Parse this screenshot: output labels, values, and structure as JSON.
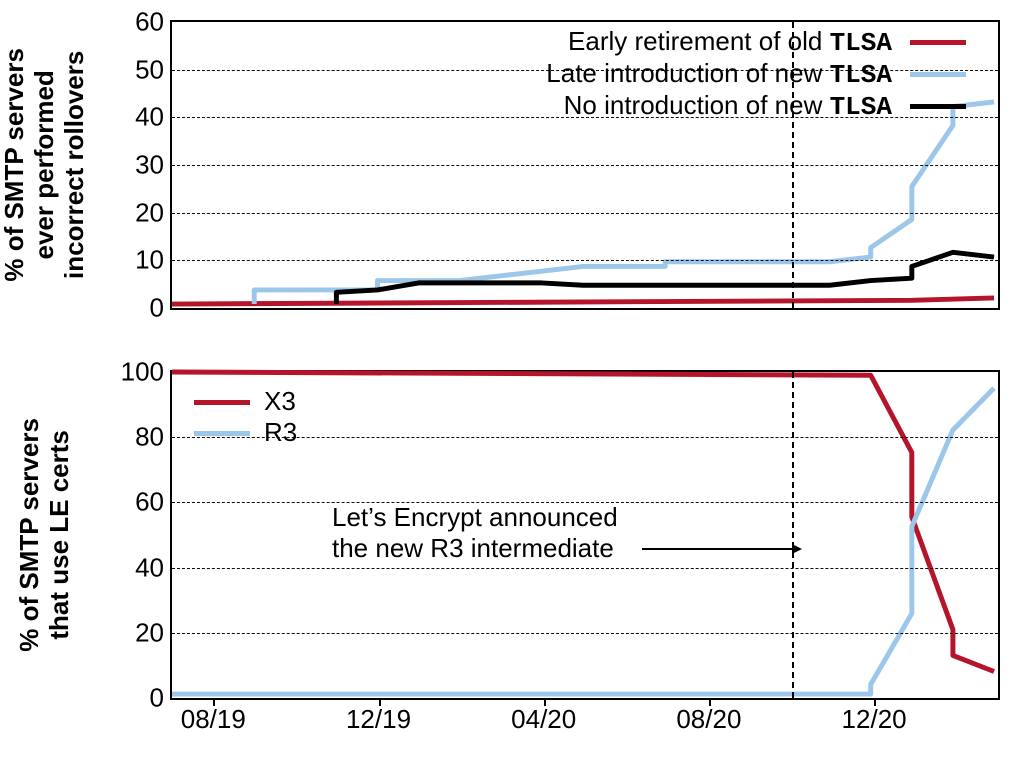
{
  "chart_data": [
    {
      "type": "line",
      "id": "top",
      "title": "",
      "xlabel": "",
      "ylabel_lines": [
        "% of SMTP servers",
        "ever performed",
        "incorrect rollovers"
      ],
      "ylim": [
        0,
        60
      ],
      "yticks": [
        0,
        10,
        20,
        30,
        40,
        50,
        60
      ],
      "x_range_months": [
        "2019-07",
        "2021-03"
      ],
      "xticks": [
        "08/19",
        "12/19",
        "04/20",
        "08/20",
        "12/20"
      ],
      "legend": [
        {
          "name_parts": [
            "Early retirement of old ",
            "TLSA"
          ],
          "color": "#b5152b"
        },
        {
          "name_parts": [
            "Late introduction of new ",
            "TLSA"
          ],
          "color": "#9cc7ea"
        },
        {
          "name_parts": [
            "No introduction of new ",
            "TLSA"
          ],
          "color": "#000000"
        }
      ],
      "annotation_vline_month": "2020-10",
      "series": [
        {
          "name": "Early retirement of old TLSA",
          "color": "#b5152b",
          "points": [
            {
              "month": "2019-07",
              "y": 0
            },
            {
              "month": "2021-01",
              "y": 0.8
            },
            {
              "month": "2021-03",
              "y": 1.3
            }
          ]
        },
        {
          "name": "Late introduction of new TLSA",
          "color": "#9cc7ea",
          "points": [
            {
              "month": "2019-09",
              "y": 0
            },
            {
              "month": "2019-09",
              "y": 3
            },
            {
              "month": "2019-12",
              "y": 3
            },
            {
              "month": "2019-12",
              "y": 5
            },
            {
              "month": "2020-02",
              "y": 5
            },
            {
              "month": "2020-04",
              "y": 7
            },
            {
              "month": "2020-05",
              "y": 8
            },
            {
              "month": "2020-07",
              "y": 8
            },
            {
              "month": "2020-07",
              "y": 9
            },
            {
              "month": "2020-11",
              "y": 9
            },
            {
              "month": "2020-12",
              "y": 10
            },
            {
              "month": "2020-12",
              "y": 12
            },
            {
              "month": "2021-01",
              "y": 18
            },
            {
              "month": "2021-01",
              "y": 25
            },
            {
              "month": "2021-02",
              "y": 38
            },
            {
              "month": "2021-02",
              "y": 42
            },
            {
              "month": "2021-03",
              "y": 43
            }
          ]
        },
        {
          "name": "No introduction of new TLSA",
          "color": "#000000",
          "points": [
            {
              "month": "2019-11",
              "y": 0
            },
            {
              "month": "2019-11",
              "y": 2.5
            },
            {
              "month": "2019-12",
              "y": 3
            },
            {
              "month": "2020-01",
              "y": 4.5
            },
            {
              "month": "2020-04",
              "y": 4.5
            },
            {
              "month": "2020-05",
              "y": 4
            },
            {
              "month": "2020-11",
              "y": 4
            },
            {
              "month": "2020-12",
              "y": 5
            },
            {
              "month": "2021-01",
              "y": 5.5
            },
            {
              "month": "2021-01",
              "y": 8
            },
            {
              "month": "2021-02",
              "y": 11
            },
            {
              "month": "2021-03",
              "y": 10
            }
          ]
        }
      ]
    },
    {
      "type": "line",
      "id": "bottom",
      "title": "",
      "xlabel": "",
      "ylabel_lines": [
        "% of SMTP servers",
        "that use LE certs"
      ],
      "ylim": [
        0,
        100
      ],
      "yticks": [
        0,
        20,
        40,
        60,
        80,
        100
      ],
      "x_range_months": [
        "2019-07",
        "2021-03"
      ],
      "xticks": [
        "08/19",
        "12/19",
        "04/20",
        "08/20",
        "12/20"
      ],
      "legend": [
        {
          "name": "X3",
          "color": "#b5152b"
        },
        {
          "name": "R3",
          "color": "#9cc7ea"
        }
      ],
      "annotation_text_lines": [
        "Let’s Encrypt announced",
        "the new R3 intermediate"
      ],
      "annotation_vline_month": "2020-10",
      "series": [
        {
          "name": "X3",
          "color": "#b5152b",
          "points": [
            {
              "month": "2019-07",
              "y": 100
            },
            {
              "month": "2020-12",
              "y": 99
            },
            {
              "month": "2020-12",
              "y": 99
            },
            {
              "month": "2021-01",
              "y": 75
            },
            {
              "month": "2021-01",
              "y": 55
            },
            {
              "month": "2021-02",
              "y": 20
            },
            {
              "month": "2021-02",
              "y": 12
            },
            {
              "month": "2021-03",
              "y": 7
            }
          ]
        },
        {
          "name": "R3",
          "color": "#9cc7ea",
          "points": [
            {
              "month": "2019-07",
              "y": 0
            },
            {
              "month": "2020-12",
              "y": 0
            },
            {
              "month": "2020-12",
              "y": 3
            },
            {
              "month": "2021-01",
              "y": 25
            },
            {
              "month": "2021-01",
              "y": 52
            },
            {
              "month": "2021-02",
              "y": 82
            },
            {
              "month": "2021-03",
              "y": 95
            }
          ]
        }
      ]
    }
  ],
  "colors": {
    "red": "#b5152b",
    "blue": "#9cc7ea",
    "black": "#000000"
  }
}
